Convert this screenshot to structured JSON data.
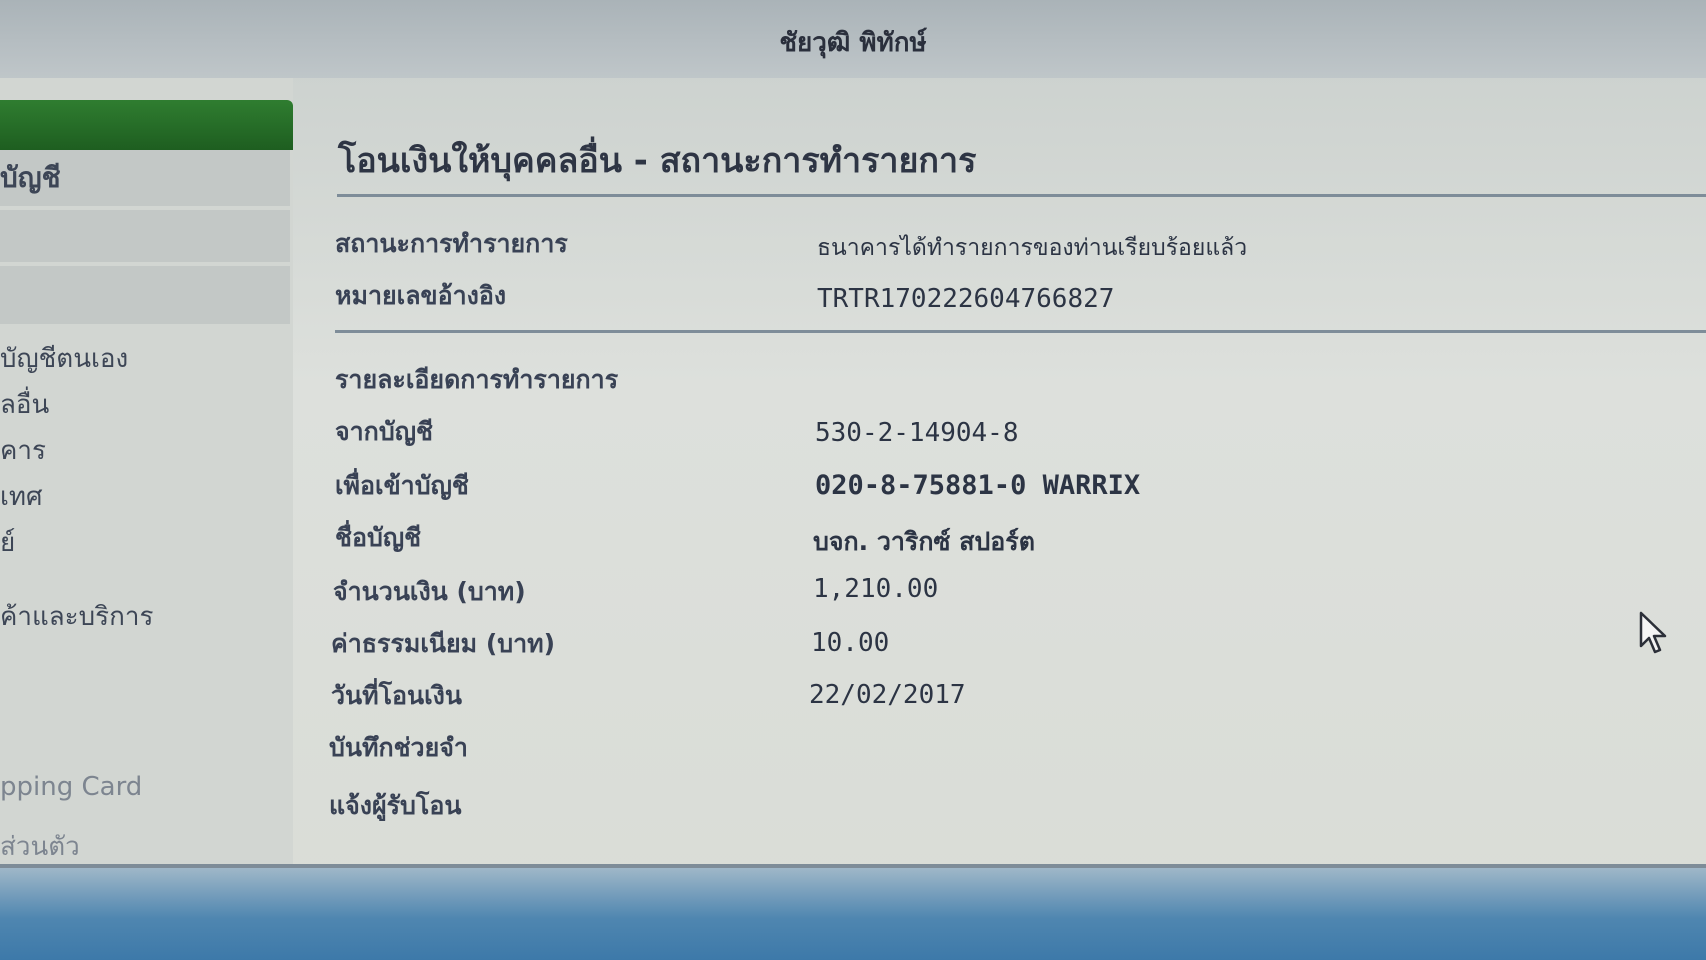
{
  "header": {
    "user_name": "ชัยวุฒิ พิทักษ์"
  },
  "sidebar": {
    "items": [
      {
        "label": "บัญชี"
      },
      {
        "label": "บัญชีตนเอง"
      },
      {
        "label": "ลอื่น"
      },
      {
        "label": "คาร"
      },
      {
        "label": "เทศ"
      },
      {
        "label": "ย์"
      },
      {
        "label": "ค้าและบริการ"
      },
      {
        "label": "pping Card"
      },
      {
        "label": "ส่วนตัว"
      }
    ]
  },
  "main": {
    "title": "โอนเงินให้บุคคลอื่น - สถานะการทำรายการ",
    "status_section": {
      "status_label": "สถานะการทำรายการ",
      "status_value": "ธนาคารได้ทำรายการของท่านเรียบร้อยแล้ว",
      "reference_label": "หมายเลขอ้างอิง",
      "reference_value": "TRTR170222604766827"
    },
    "details_section": {
      "heading": "รายละเอียดการทำรายการ",
      "from_account_label": "จากบัญชี",
      "from_account_value": "530-2-14904-8",
      "to_account_label": "เพื่อเข้าบัญชี",
      "to_account_value": "020-8-75881-0 WARRIX",
      "account_name_label": "ชื่อบัญชี",
      "account_name_value": "บจก. วาริกซ์ สปอร์ต",
      "amount_label": "จำนวนเงิน (บาท)",
      "amount_value": "1,210.00",
      "fee_label": "ค่าธรรมเนียม (บาท)",
      "fee_value": "10.00",
      "date_label": "วันที่โอนเงิน",
      "date_value": "22/02/2017",
      "memo_label": "บันทึกช่วยจำ",
      "notify_label": "แจ้งผู้รับโอน"
    }
  },
  "colors": {
    "sidebar_active": "#2f7d30",
    "text": "#2e3544",
    "divider": "#7e8d99"
  }
}
